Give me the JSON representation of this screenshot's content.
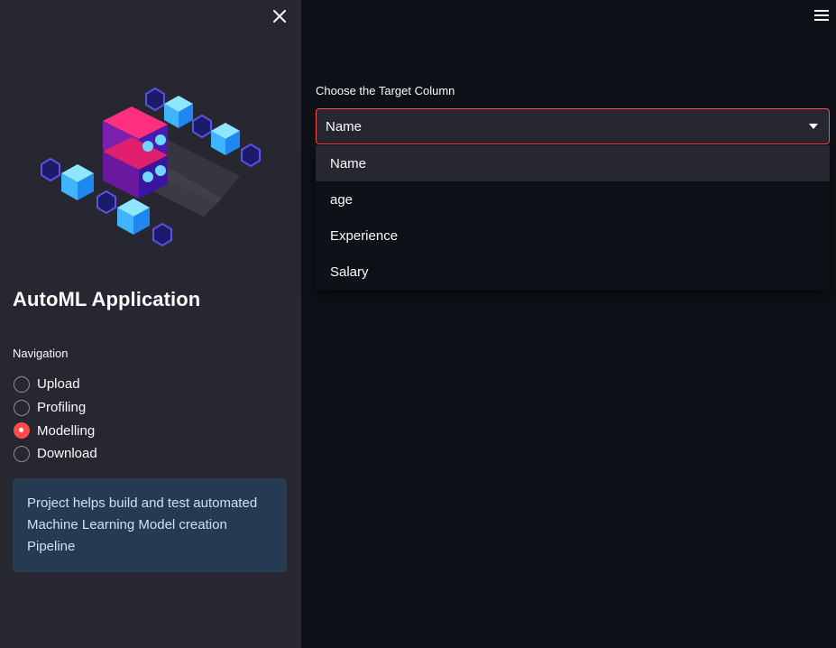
{
  "sidebar": {
    "title": "AutoML Application",
    "nav_label": "Navigation",
    "nav_options": [
      {
        "label": "Upload",
        "selected": false
      },
      {
        "label": "Profiling",
        "selected": false
      },
      {
        "label": "Modelling",
        "selected": true
      },
      {
        "label": "Download",
        "selected": false
      }
    ],
    "info_text": "Project helps build and test automated Machine Learning Model creation Pipeline",
    "close_icon": "close-icon"
  },
  "main": {
    "menu_icon": "hamburger-menu-icon",
    "select_label": "Choose the Target Column",
    "select_value": "Name",
    "options": [
      "Name",
      "age",
      "Experience",
      "Salary"
    ],
    "highlighted_option": "Name"
  },
  "colors": {
    "accent": "#ff4b4b",
    "background": "#0e1117",
    "sidebar_bg": "#262730",
    "info_bg": "#263a52",
    "info_text": "#c7e3ff"
  }
}
